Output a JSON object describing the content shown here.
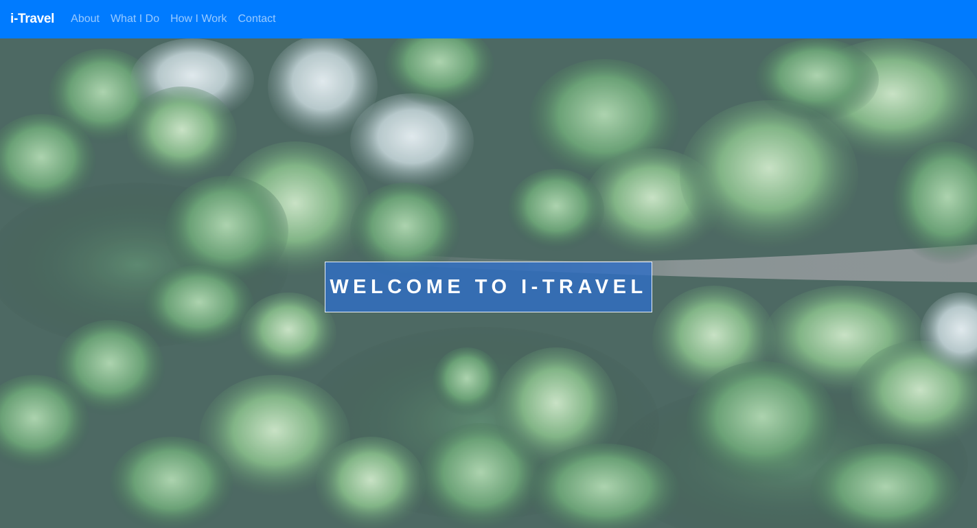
{
  "navbar": {
    "brand": "i-Travel",
    "links": [
      "About",
      "What I Do",
      "How I Work",
      "Contact"
    ],
    "bg_color": "#007bff"
  },
  "hero": {
    "background": "aerial photo of forest with dirt road",
    "heading": "WELCOME TO I-TRAVEL",
    "box_color": "#2e6ec8"
  }
}
